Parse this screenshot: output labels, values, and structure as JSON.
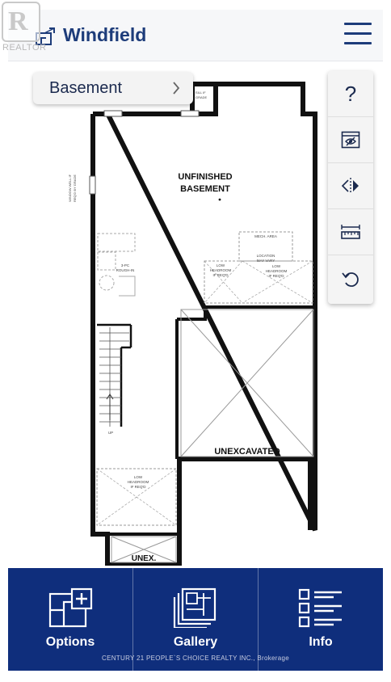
{
  "watermark": {
    "brand": "R",
    "text": "REALTOR"
  },
  "header": {
    "app_name": "Windfield"
  },
  "floor_selector": {
    "selected": "Basement"
  },
  "plan": {
    "room_main": "UNFINISHED",
    "room_main_2": "BASEMENT",
    "room_unexcavated": "UNEXCAVATED",
    "room_unex": "UNEX.",
    "mech_area": "MECH. AREA",
    "location_may_vary": "LOCATION",
    "location_may_vary_2": "MAY VARY",
    "low_headroom_a": "LOW",
    "low_headroom_a2": "HEADROOM",
    "low_headroom_a3": "IF REQ'D",
    "low_headroom_b": "LOW",
    "low_headroom_b2": "HEADROOM",
    "low_headroom_b3": "IF REQ'D",
    "low_headroom_c": "LOW",
    "low_headroom_c2": "HEADROOM",
    "low_headroom_c3": "IF REQ'D",
    "rough_in": "3-PC",
    "rough_in_2": "ROUGH-IN",
    "stair_up": "UP",
    "window_note": "WINDOW WELL IF",
    "window_note_2": "REQ'D BY GRADE",
    "sill_note": "SILL IF",
    "sill_note_2": "GRADE"
  },
  "tools": [
    {
      "icon": "help-icon",
      "label": "?"
    },
    {
      "icon": "eye-view-icon"
    },
    {
      "icon": "mirror-flip-icon"
    },
    {
      "icon": "measure-ruler-icon"
    },
    {
      "icon": "undo-icon"
    }
  ],
  "bottom_nav": {
    "options": "Options",
    "gallery": "Gallery",
    "info": "Info"
  },
  "credit": "CENTURY 21 PEOPLE`S CHOICE REALTY INC., Brokerage",
  "colors": {
    "brand": "#1d3c7a",
    "nav_bg": "#0f2e7c",
    "wall": "#111111"
  }
}
